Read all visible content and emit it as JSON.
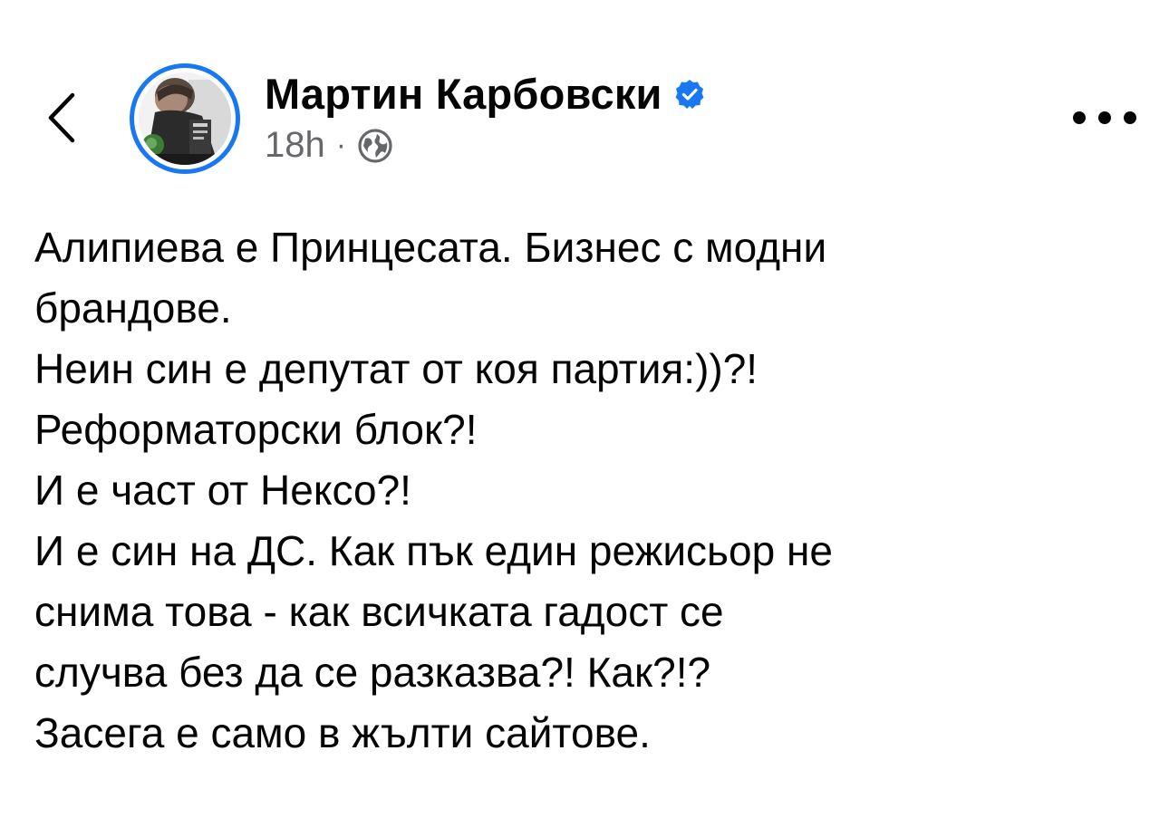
{
  "header": {
    "back_icon": "chevron-left-icon",
    "author_name": "Мартин Карбовски",
    "verified_icon": "verified-badge-icon",
    "timestamp": "18h",
    "separator": "·",
    "audience_icon": "globe-icon",
    "more_icon": "more-horizontal-icon"
  },
  "post": {
    "lines": [
      "Алипиева е Принцесата. Бизнес с модни",
      "брандове.",
      "Неин син е депутат от коя партия:))?!",
      "Реформаторски блок?!",
      "И е част от Нексо?!",
      "И е син на ДС. Как пък един режисьор не",
      "снима това - как всичката гадост се",
      "случва без да се разказва?! Как?!?",
      "Засега е само в жълти сайтове."
    ]
  },
  "colors": {
    "accent": "#1877f2",
    "text": "#050505",
    "secondary": "#65676b",
    "background": "#ffffff"
  }
}
